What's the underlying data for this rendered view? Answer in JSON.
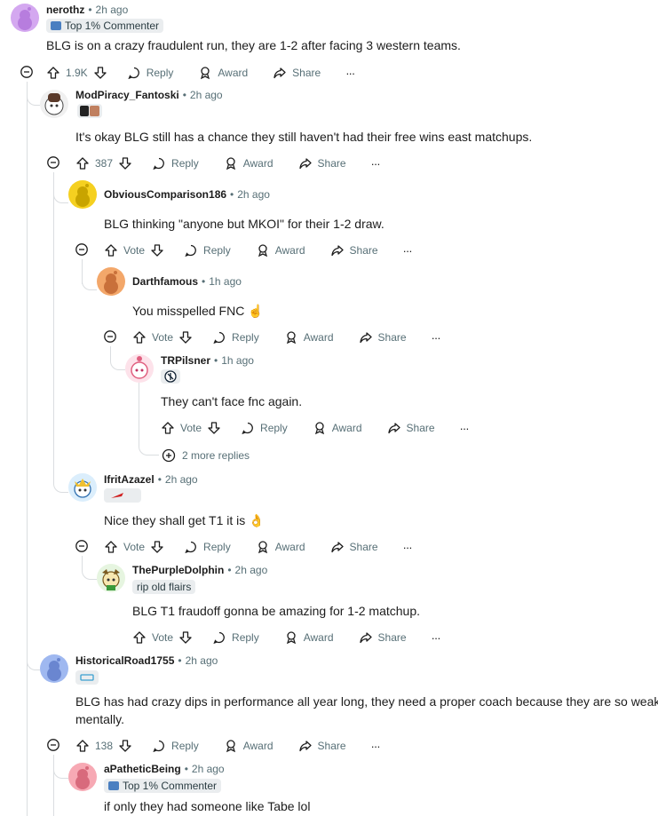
{
  "comments": [
    {
      "user": "nerothz",
      "time": "2h ago",
      "flair": "Top 1% Commenter",
      "body": "BLG is on a crazy fraudulent run, they are 1-2 after facing 3 western teams.",
      "votes": "1.9K"
    },
    {
      "user": "ModPiracy_Fantoski",
      "time": "2h ago",
      "body": "It's okay BLG still has a chance they still haven't had their free wins east matchups.",
      "votes": "387"
    },
    {
      "user": "ObviousComparison186",
      "time": "2h ago",
      "body": "BLG thinking \"anyone but MKOI\" for their 1-2 draw.",
      "votes": "Vote"
    },
    {
      "user": "Darthfamous",
      "time": "1h ago",
      "body": "You misspelled FNC ☝️",
      "votes": "Vote"
    },
    {
      "user": "TRPilsner",
      "time": "1h ago",
      "body": "They can't face fnc again.",
      "votes": "Vote"
    },
    {
      "user": "IfritAzazel",
      "time": "2h ago",
      "body": "Nice they shall get T1 it is 👌",
      "votes": "Vote"
    },
    {
      "user": "ThePurpleDolphin",
      "time": "2h ago",
      "flair": "rip old flairs",
      "body": "BLG T1 fraudoff gonna be amazing for 1-2 matchup.",
      "votes": "Vote"
    },
    {
      "user": "HistoricalRoad1755",
      "time": "2h ago",
      "body_line1": "BLG has had crazy dips in performance all year long, they need a proper coach because they are so weak",
      "body_line2": "mentally.",
      "votes": "138"
    },
    {
      "user": "aPatheticBeing",
      "time": "2h ago",
      "flair": "Top 1% Commenter",
      "body": "if only they had someone like Tabe lol"
    }
  ],
  "labels": {
    "reply": "Reply",
    "award": "Award",
    "share": "Share",
    "more": "···"
  },
  "more_replies": "2 more replies",
  "colors": {
    "text": "#1c1c1c",
    "meta": "#576f76",
    "thread": "#dadde0",
    "flair_bg": "#eaedef"
  }
}
